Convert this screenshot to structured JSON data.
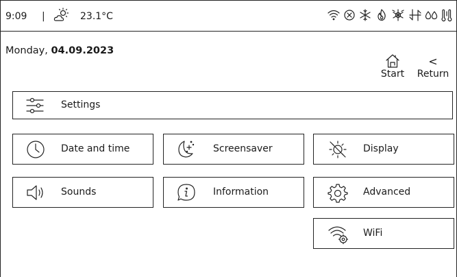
{
  "status_bar": {
    "time": "9:09",
    "separator": "|",
    "weather_icon": "partly-sunny-icon",
    "temperature": "23.1°C",
    "indicators": [
      "wifi-icon",
      "error-circle-icon",
      "snowflake-icon",
      "heating-flame-icon",
      "defrost-icon",
      "airflow-icon",
      "humidity-icon",
      "thermometer-pair-icon"
    ]
  },
  "header": {
    "date_prefix": "Monday, ",
    "date_value": "04.09.2023",
    "start_label": "Start",
    "return_label": "Return",
    "return_glyph": "<"
  },
  "menu": {
    "settings": "Settings",
    "date_time": "Date and time",
    "screensaver": "Screensaver",
    "display": "Display",
    "sounds": "Sounds",
    "information": "Information",
    "advanced": "Advanced",
    "wifi": "WiFi"
  }
}
